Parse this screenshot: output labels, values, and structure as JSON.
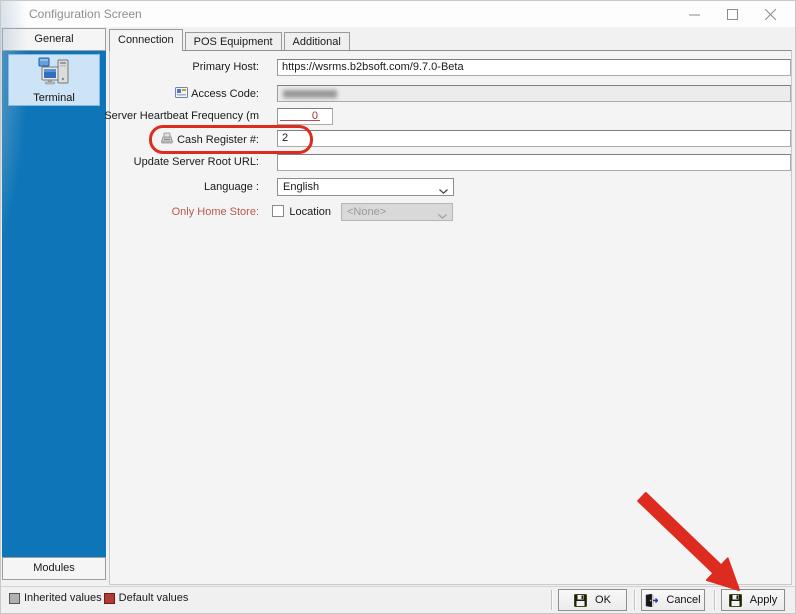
{
  "window": {
    "title": "Configuration Screen",
    "controls": {
      "minimize": "minimize",
      "maximize": "maximize",
      "close": "close"
    }
  },
  "sidebar": {
    "top_button": "General",
    "bottom_button": "Modules",
    "items": [
      {
        "label": "Terminal",
        "icon": "terminal-computer-icon",
        "selected": true
      }
    ],
    "accent_color": "#0e76b8"
  },
  "tabs": [
    {
      "label": "Connection",
      "active": true
    },
    {
      "label": "POS Equipment",
      "active": false
    },
    {
      "label": "Additional",
      "active": false
    }
  ],
  "form": {
    "primary_host": {
      "label": "Primary Host:",
      "value": "https://wsrms.b2bsoft.com/9.7.0-Beta"
    },
    "access_code": {
      "label": "Access Code:",
      "value": "",
      "masked": true,
      "icon": "id-card-icon"
    },
    "heartbeat": {
      "label": "Server Heartbeat Frequency (m",
      "value": "0",
      "value_color": "#a33530"
    },
    "cash_register": {
      "label": "Cash Register #:",
      "value": "2",
      "icon": "cash-register-icon"
    },
    "update_server_root_url": {
      "label": "Update Server Root URL:",
      "value": ""
    },
    "language": {
      "label": "Language :",
      "value": "English"
    },
    "only_home_store": {
      "label": "Only Home Store:",
      "checked": false,
      "label_color": "#b9584a"
    },
    "location": {
      "label": "Location",
      "value": "<None>",
      "disabled": true
    }
  },
  "status_bar": {
    "legend": [
      {
        "label": "Inherited values",
        "color": "#b0b0b0"
      },
      {
        "label": "Default values",
        "color": "#b03a34"
      }
    ],
    "buttons": [
      {
        "label": "OK",
        "icon": "save-floppy-icon"
      },
      {
        "label": "Cancel",
        "icon": "exit-door-icon"
      },
      {
        "label": "Apply",
        "icon": "save-floppy-icon"
      }
    ]
  },
  "annotations": {
    "oval_target": "cash-register-field",
    "arrow_target": "apply-button",
    "color": "#de2b1f"
  }
}
